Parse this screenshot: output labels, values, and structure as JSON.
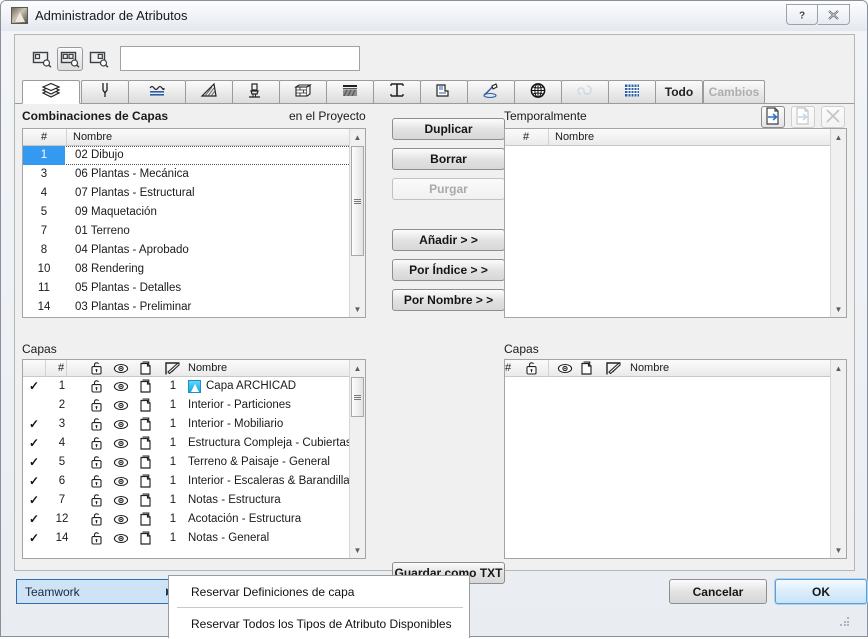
{
  "window": {
    "title": "Administrador de Atributos",
    "help_label": "?",
    "close_label": "✖"
  },
  "toolbar": {
    "search_placeholder": "",
    "search_value": "",
    "buttons": [
      {
        "name": "search-left-panel-icon",
        "label": ""
      },
      {
        "name": "search-both-panels-icon",
        "label": ""
      },
      {
        "name": "search-right-panel-icon",
        "label": ""
      }
    ]
  },
  "tabs": [
    {
      "label": "",
      "icon": "layers-icon",
      "selected": true,
      "disabled": false
    },
    {
      "label": "",
      "icon": "pen-icon",
      "selected": false,
      "disabled": false
    },
    {
      "label": "",
      "icon": "line-type-icon",
      "selected": false,
      "disabled": false
    },
    {
      "label": "",
      "icon": "fill-pattern-icon",
      "selected": false,
      "disabled": false
    },
    {
      "label": "",
      "icon": "surface-brush-icon",
      "selected": false,
      "disabled": false
    },
    {
      "label": "",
      "icon": "building-material-icon",
      "selected": false,
      "disabled": false
    },
    {
      "label": "",
      "icon": "composite-icon",
      "selected": false,
      "disabled": false
    },
    {
      "label": "",
      "icon": "profile-icon",
      "selected": false,
      "disabled": false
    },
    {
      "label": "",
      "icon": "zone-category-icon",
      "selected": false,
      "disabled": false
    },
    {
      "label": "",
      "icon": "pen-set-icon",
      "selected": false,
      "disabled": false
    },
    {
      "label": "",
      "icon": "city-globe-icon",
      "selected": false,
      "disabled": false
    },
    {
      "label": "",
      "icon": "mep-system-icon",
      "selected": false,
      "disabled": true
    },
    {
      "label": "",
      "icon": "grid-icon",
      "selected": false,
      "disabled": false
    },
    {
      "label": "Todo",
      "icon": "",
      "selected": false,
      "disabled": false
    },
    {
      "label": "Cambios",
      "icon": "",
      "selected": false,
      "disabled": true
    }
  ],
  "left_top": {
    "title": "Combinaciones de Capas",
    "source_label": "en el Proyecto",
    "columns": [
      "#",
      "Nombre"
    ],
    "rows": [
      {
        "num": "1",
        "name": "02 Dibujo",
        "selected": true
      },
      {
        "num": "3",
        "name": "06 Plantas - Mecánica",
        "selected": false
      },
      {
        "num": "4",
        "name": "07 Plantas - Estructural",
        "selected": false
      },
      {
        "num": "5",
        "name": "09 Maquetación",
        "selected": false
      },
      {
        "num": "7",
        "name": "01 Terreno",
        "selected": false
      },
      {
        "num": "8",
        "name": "04 Plantas - Aprobado",
        "selected": false
      },
      {
        "num": "10",
        "name": "08 Rendering",
        "selected": false
      },
      {
        "num": "11",
        "name": "05 Plantas - Detalles",
        "selected": false
      },
      {
        "num": "14",
        "name": "03 Plantas - Preliminar",
        "selected": false
      }
    ]
  },
  "center_buttons": [
    {
      "label": "Duplicar",
      "disabled": false
    },
    {
      "label": "Borrar",
      "disabled": false
    },
    {
      "label": "Purgar",
      "disabled": true
    },
    {
      "label": "Añadir > >",
      "disabled": false
    },
    {
      "label": "Por Índice > >",
      "disabled": false
    },
    {
      "label": "Por Nombre > >",
      "disabled": false
    }
  ],
  "save_txt_button": {
    "label": "Guardar como TXT"
  },
  "right_top": {
    "title": "Temporalmente",
    "columns": [
      "#",
      "Nombre"
    ],
    "rows": [],
    "icon_buttons": [
      {
        "name": "open-file-icon",
        "disabled": false
      },
      {
        "name": "save-file-icon",
        "disabled": true
      },
      {
        "name": "close-file-icon",
        "disabled": true
      }
    ]
  },
  "left_bottom": {
    "title": "Capas",
    "columns": [
      "",
      "#",
      "lock-icon",
      "eye-icon",
      "wireframe-icon",
      "intersection-icon",
      "Nombre"
    ],
    "rows": [
      {
        "checked": true,
        "num": "1",
        "group": "1",
        "name": "Capa ARCHICAD",
        "has_icon": true
      },
      {
        "checked": false,
        "num": "2",
        "group": "1",
        "name": "Interior - Particiones",
        "has_icon": false
      },
      {
        "checked": true,
        "num": "3",
        "group": "1",
        "name": "Interior - Mobiliario",
        "has_icon": false
      },
      {
        "checked": true,
        "num": "4",
        "group": "1",
        "name": "Estructura Compleja - Cubiertas",
        "has_icon": false
      },
      {
        "checked": true,
        "num": "5",
        "group": "1",
        "name": "Terreno & Paisaje - General",
        "has_icon": false
      },
      {
        "checked": true,
        "num": "6",
        "group": "1",
        "name": "Interior - Escaleras & Barandillas",
        "has_icon": false
      },
      {
        "checked": true,
        "num": "7",
        "group": "1",
        "name": "Notas - Estructura",
        "has_icon": false
      },
      {
        "checked": true,
        "num": "12",
        "group": "1",
        "name": "Acotación - Estructura",
        "has_icon": false
      },
      {
        "checked": true,
        "num": "14",
        "group": "1",
        "name": "Notas - General",
        "has_icon": false
      }
    ]
  },
  "right_bottom": {
    "title": "Capas",
    "columns": [
      "#",
      "lock-icon",
      "eye-icon",
      "wireframe-icon",
      "intersection-icon",
      "Nombre"
    ],
    "rows": []
  },
  "footer": {
    "teamwork_label": "Teamwork",
    "cancel_label": "Cancelar",
    "ok_label": "OK",
    "context_menu": [
      {
        "label": "Reservar Definiciones de capa"
      },
      {
        "label": "Reservar Todos los Tipos de Atributo Disponibles"
      }
    ]
  },
  "colors": {
    "selection_blue": "#3399f1",
    "accent_border": "#2a6fb5",
    "menu_highlight": "#cfe3f7",
    "archicad_icon": "#1aa6e0"
  }
}
